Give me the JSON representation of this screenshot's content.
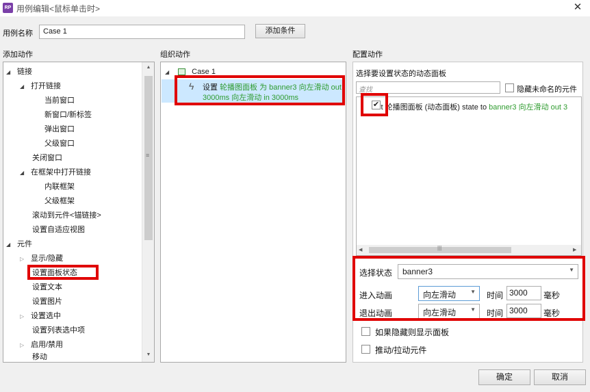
{
  "window": {
    "app_icon": "RP",
    "title": "用例编辑<鼠标单击时>",
    "close": "✕"
  },
  "case_name": {
    "label": "用例名称",
    "value": "Case 1",
    "add_condition": "添加条件"
  },
  "sections": {
    "add_actions": "添加动作",
    "organize_actions": "组织动作",
    "configure_actions": "配置动作"
  },
  "add_tree": [
    "链接",
    "打开链接",
    "当前窗口",
    "新窗口/新标签",
    "弹出窗口",
    "父级窗口",
    "关闭窗口",
    "在框架中打开链接",
    "内联框架",
    "父级框架",
    "滚动到元件<锚链接>",
    "设置自适应视图",
    "元件",
    "显示/隐藏",
    "设置面板状态",
    "设置文本",
    "设置图片",
    "设置选中",
    "设置列表选中项",
    "启用/禁用",
    "移动"
  ],
  "organize": {
    "case_label": "Case 1",
    "action_line1_prefix": "设置",
    "action_line1_green": "轮播图面板 为 banner3 向左滑动 out",
    "action_line2": "3000ms 向左滑动 in 3000ms"
  },
  "configure": {
    "heading": "选择要设置状态的动态面板",
    "search_placeholder": "查找",
    "hide_unnamed": "隐藏未命名的元件",
    "item_black": "Set 轮播图面板 (动态面板) state to",
    "item_green": "banner3 向左滑动 out 3",
    "select_state_label": "选择状态",
    "select_state_value": "banner3",
    "enter_anim_label": "进入动画",
    "enter_anim_value": "向左滑动",
    "exit_anim_label": "退出动画",
    "exit_anim_value": "向左滑动",
    "time_label": "时间",
    "enter_time": "3000",
    "exit_time": "3000",
    "ms_label": "毫秒",
    "show_if_hidden": "如果隐藏则显示面板",
    "push_pull": "推动/拉动元件"
  },
  "footer": {
    "ok": "确定",
    "cancel": "取消"
  },
  "colors": {
    "highlight_red": "#e00000",
    "action_green": "#2e9b2e",
    "selected_row": "#cce8ff"
  }
}
